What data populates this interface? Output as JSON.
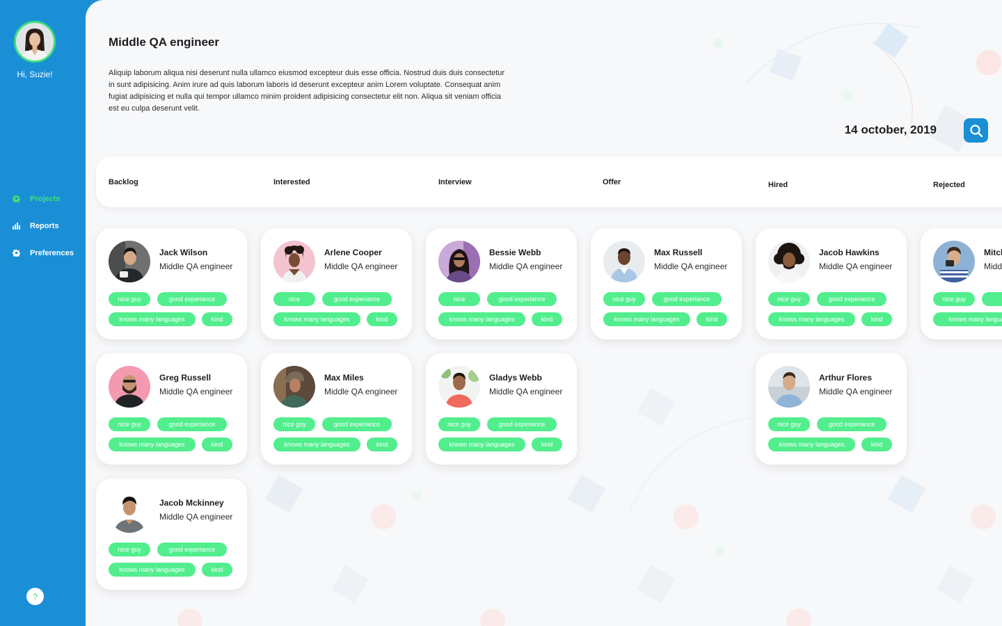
{
  "user": {
    "greeting": "Hi, Suzie!"
  },
  "nav": {
    "items": [
      {
        "label": "Projects",
        "icon": "gear-icon",
        "active": true
      },
      {
        "label": "Reports",
        "icon": "bar-chart-icon",
        "active": false
      },
      {
        "label": "Preferences",
        "icon": "gear-icon",
        "active": false
      }
    ],
    "help_label": "?"
  },
  "job": {
    "title": "Middle QA engineer",
    "description": "Aliquip laborum aliqua nisi deserunt nulla ullamco eiusmod excepteur duis esse officia. Nostrud duis duis consectetur in sunt adipisicing. Anim irure ad quis laborum laboris id deserunt excepteur anim Lorem voluptate. Consequat anim fugiat adipisicing et nulla qui tempor ullamco minim proident adipisicing consectetur elit non. Aliqua sit veniam officia est eu culpa deserunt velit."
  },
  "date": "14 october, 2019",
  "stages": [
    "Backlog",
    "Interested",
    "Interview",
    "Offer",
    "Hired",
    "Rejected"
  ],
  "candidates": [
    {
      "name": "Jack Wilson",
      "role": "Middle QA engineer",
      "tags": [
        "nice guy",
        "good experiance",
        "knows many languages",
        "kind"
      ]
    },
    {
      "name": "Arlene Cooper",
      "role": "Middle QA engineer",
      "tags": [
        "nice",
        "good experiance",
        "knows many languages",
        "kind"
      ]
    },
    {
      "name": "Bessie Webb",
      "role": "Middle QA engineer",
      "tags": [
        "nice",
        "good experiance",
        "knows many languages",
        "kind"
      ]
    },
    {
      "name": "Max Russell",
      "role": "Middle QA engineer",
      "tags": [
        "nice guy",
        "good experiance",
        "knows many languages",
        "kind"
      ]
    },
    {
      "name": "Jacob Hawkins",
      "role": "Middle QA engineer",
      "tags": [
        "nice guy",
        "good experiance",
        "knows many languages",
        "kind"
      ]
    },
    {
      "name": "Mitcl",
      "role": "Midd",
      "tags": [
        "nice guy",
        "goo",
        "knows many langua",
        ""
      ]
    },
    {
      "name": "Greg Russell",
      "role": "Middle QA engineer",
      "tags": [
        "nice guy",
        "good experiance",
        "knows many languages",
        "kind"
      ]
    },
    {
      "name": "Max Miles",
      "role": "Middle QA engineer",
      "tags": [
        "nice guy",
        "good experiance",
        "knows many languages",
        "kind"
      ]
    },
    {
      "name": "Gladys Webb",
      "role": "Middle QA engineer",
      "tags": [
        "nice guy",
        "good experiance",
        "knows many languages",
        "kind"
      ]
    },
    {
      "name": "Arthur Flores",
      "role": "Middle QA engineer",
      "tags": [
        "nice guy",
        "good experiance",
        "knows many languages",
        "kind"
      ]
    },
    {
      "name": "Jacob Mckinney",
      "role": "Middle QA engineer",
      "tags": [
        "nice guy",
        "good experiance",
        "knows many languages",
        "kind"
      ]
    }
  ],
  "colors": {
    "sidebar": "#1b8fd6",
    "accent": "#3ee07a",
    "tag": "#52ee8e",
    "background": "#f7f8fa"
  }
}
